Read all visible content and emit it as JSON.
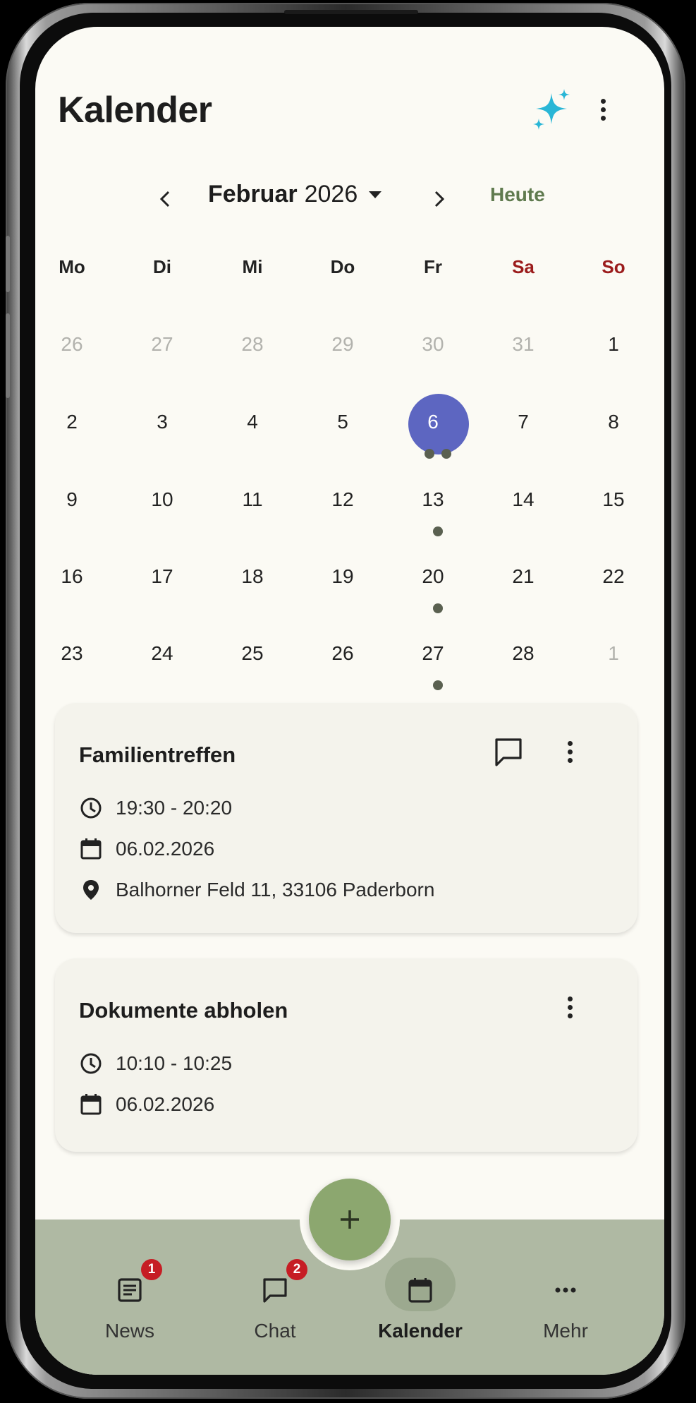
{
  "header": {
    "title": "Kalender",
    "sparkle_color": "#29b6d6"
  },
  "month_nav": {
    "month": "Februar",
    "year": "2026",
    "today_label": "Heute"
  },
  "weekdays": [
    "Mo",
    "Di",
    "Mi",
    "Do",
    "Fr",
    "Sa",
    "So"
  ],
  "weeks": [
    [
      "26",
      "27",
      "28",
      "29",
      "30",
      "31",
      "1"
    ],
    [
      "2",
      "3",
      "4",
      "5",
      "6",
      "7",
      "8"
    ],
    [
      "9",
      "10",
      "11",
      "12",
      "13",
      "14",
      "15"
    ],
    [
      "16",
      "17",
      "18",
      "19",
      "20",
      "21",
      "22"
    ],
    [
      "23",
      "24",
      "25",
      "26",
      "27",
      "28",
      "1"
    ]
  ],
  "selected_day": "6",
  "events": [
    {
      "title": "Familientreffen",
      "time": "19:30 - 20:20",
      "date": "06.02.2026",
      "location": "Balhorner Feld 11, 33106 Paderborn"
    },
    {
      "title": "Dokumente abholen",
      "time": "10:10 - 10:25",
      "date": "06.02.2026"
    }
  ],
  "nav": [
    {
      "label": "News",
      "icon": "news-icon",
      "badge": "1"
    },
    {
      "label": "Chat",
      "icon": "chat-icon",
      "badge": "2"
    },
    {
      "label": "Kalender",
      "icon": "calendar-icon",
      "active": true
    },
    {
      "label": "Mehr",
      "icon": "more-icon"
    }
  ],
  "fab": {
    "icon": "plus-icon",
    "color": "#8ca76f"
  },
  "colors": {
    "accent": "#5d66c1",
    "weekend": "#9b1c1c",
    "nav_bg": "#afb9a3",
    "today": "#5f7a4e"
  }
}
